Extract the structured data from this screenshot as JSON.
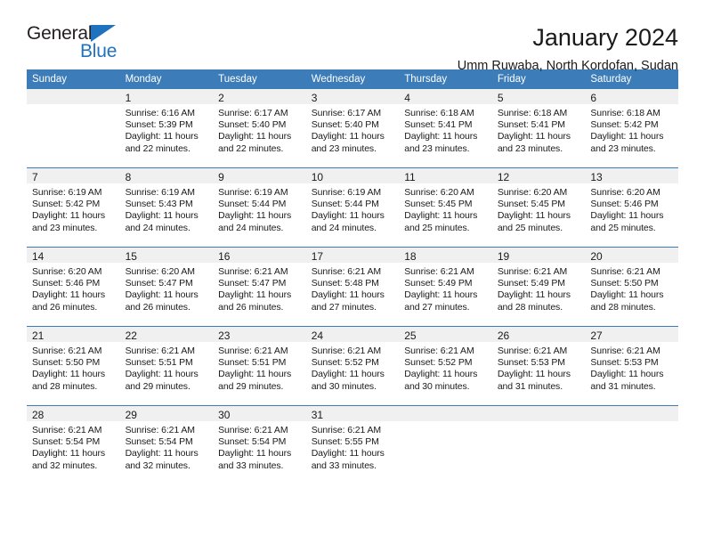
{
  "brand": {
    "name_top": "General",
    "name_bottom": "Blue",
    "accent_color": "#1f72bd"
  },
  "header": {
    "title": "January 2024",
    "subtitle": "Umm Ruwaba, North Kordofan, Sudan"
  },
  "calendar": {
    "header_bg": "#3c7cb8",
    "header_text_color": "#ffffff",
    "daynum_band_bg": "#f0f0f0",
    "weekday_headers": [
      "Sunday",
      "Monday",
      "Tuesday",
      "Wednesday",
      "Thursday",
      "Friday",
      "Saturday"
    ],
    "weeks": [
      [
        {
          "day": ""
        },
        {
          "day": "1",
          "lines": [
            "Sunrise: 6:16 AM",
            "Sunset: 5:39 PM",
            "Daylight: 11 hours",
            "and 22 minutes."
          ]
        },
        {
          "day": "2",
          "lines": [
            "Sunrise: 6:17 AM",
            "Sunset: 5:40 PM",
            "Daylight: 11 hours",
            "and 22 minutes."
          ]
        },
        {
          "day": "3",
          "lines": [
            "Sunrise: 6:17 AM",
            "Sunset: 5:40 PM",
            "Daylight: 11 hours",
            "and 23 minutes."
          ]
        },
        {
          "day": "4",
          "lines": [
            "Sunrise: 6:18 AM",
            "Sunset: 5:41 PM",
            "Daylight: 11 hours",
            "and 23 minutes."
          ]
        },
        {
          "day": "5",
          "lines": [
            "Sunrise: 6:18 AM",
            "Sunset: 5:41 PM",
            "Daylight: 11 hours",
            "and 23 minutes."
          ]
        },
        {
          "day": "6",
          "lines": [
            "Sunrise: 6:18 AM",
            "Sunset: 5:42 PM",
            "Daylight: 11 hours",
            "and 23 minutes."
          ]
        }
      ],
      [
        {
          "day": "7",
          "lines": [
            "Sunrise: 6:19 AM",
            "Sunset: 5:42 PM",
            "Daylight: 11 hours",
            "and 23 minutes."
          ]
        },
        {
          "day": "8",
          "lines": [
            "Sunrise: 6:19 AM",
            "Sunset: 5:43 PM",
            "Daylight: 11 hours",
            "and 24 minutes."
          ]
        },
        {
          "day": "9",
          "lines": [
            "Sunrise: 6:19 AM",
            "Sunset: 5:44 PM",
            "Daylight: 11 hours",
            "and 24 minutes."
          ]
        },
        {
          "day": "10",
          "lines": [
            "Sunrise: 6:19 AM",
            "Sunset: 5:44 PM",
            "Daylight: 11 hours",
            "and 24 minutes."
          ]
        },
        {
          "day": "11",
          "lines": [
            "Sunrise: 6:20 AM",
            "Sunset: 5:45 PM",
            "Daylight: 11 hours",
            "and 25 minutes."
          ]
        },
        {
          "day": "12",
          "lines": [
            "Sunrise: 6:20 AM",
            "Sunset: 5:45 PM",
            "Daylight: 11 hours",
            "and 25 minutes."
          ]
        },
        {
          "day": "13",
          "lines": [
            "Sunrise: 6:20 AM",
            "Sunset: 5:46 PM",
            "Daylight: 11 hours",
            "and 25 minutes."
          ]
        }
      ],
      [
        {
          "day": "14",
          "lines": [
            "Sunrise: 6:20 AM",
            "Sunset: 5:46 PM",
            "Daylight: 11 hours",
            "and 26 minutes."
          ]
        },
        {
          "day": "15",
          "lines": [
            "Sunrise: 6:20 AM",
            "Sunset: 5:47 PM",
            "Daylight: 11 hours",
            "and 26 minutes."
          ]
        },
        {
          "day": "16",
          "lines": [
            "Sunrise: 6:21 AM",
            "Sunset: 5:47 PM",
            "Daylight: 11 hours",
            "and 26 minutes."
          ]
        },
        {
          "day": "17",
          "lines": [
            "Sunrise: 6:21 AM",
            "Sunset: 5:48 PM",
            "Daylight: 11 hours",
            "and 27 minutes."
          ]
        },
        {
          "day": "18",
          "lines": [
            "Sunrise: 6:21 AM",
            "Sunset: 5:49 PM",
            "Daylight: 11 hours",
            "and 27 minutes."
          ]
        },
        {
          "day": "19",
          "lines": [
            "Sunrise: 6:21 AM",
            "Sunset: 5:49 PM",
            "Daylight: 11 hours",
            "and 28 minutes."
          ]
        },
        {
          "day": "20",
          "lines": [
            "Sunrise: 6:21 AM",
            "Sunset: 5:50 PM",
            "Daylight: 11 hours",
            "and 28 minutes."
          ]
        }
      ],
      [
        {
          "day": "21",
          "lines": [
            "Sunrise: 6:21 AM",
            "Sunset: 5:50 PM",
            "Daylight: 11 hours",
            "and 28 minutes."
          ]
        },
        {
          "day": "22",
          "lines": [
            "Sunrise: 6:21 AM",
            "Sunset: 5:51 PM",
            "Daylight: 11 hours",
            "and 29 minutes."
          ]
        },
        {
          "day": "23",
          "lines": [
            "Sunrise: 6:21 AM",
            "Sunset: 5:51 PM",
            "Daylight: 11 hours",
            "and 29 minutes."
          ]
        },
        {
          "day": "24",
          "lines": [
            "Sunrise: 6:21 AM",
            "Sunset: 5:52 PM",
            "Daylight: 11 hours",
            "and 30 minutes."
          ]
        },
        {
          "day": "25",
          "lines": [
            "Sunrise: 6:21 AM",
            "Sunset: 5:52 PM",
            "Daylight: 11 hours",
            "and 30 minutes."
          ]
        },
        {
          "day": "26",
          "lines": [
            "Sunrise: 6:21 AM",
            "Sunset: 5:53 PM",
            "Daylight: 11 hours",
            "and 31 minutes."
          ]
        },
        {
          "day": "27",
          "lines": [
            "Sunrise: 6:21 AM",
            "Sunset: 5:53 PM",
            "Daylight: 11 hours",
            "and 31 minutes."
          ]
        }
      ],
      [
        {
          "day": "28",
          "lines": [
            "Sunrise: 6:21 AM",
            "Sunset: 5:54 PM",
            "Daylight: 11 hours",
            "and 32 minutes."
          ]
        },
        {
          "day": "29",
          "lines": [
            "Sunrise: 6:21 AM",
            "Sunset: 5:54 PM",
            "Daylight: 11 hours",
            "and 32 minutes."
          ]
        },
        {
          "day": "30",
          "lines": [
            "Sunrise: 6:21 AM",
            "Sunset: 5:54 PM",
            "Daylight: 11 hours",
            "and 33 minutes."
          ]
        },
        {
          "day": "31",
          "lines": [
            "Sunrise: 6:21 AM",
            "Sunset: 5:55 PM",
            "Daylight: 11 hours",
            "and 33 minutes."
          ]
        },
        {
          "day": ""
        },
        {
          "day": ""
        },
        {
          "day": ""
        }
      ]
    ]
  }
}
